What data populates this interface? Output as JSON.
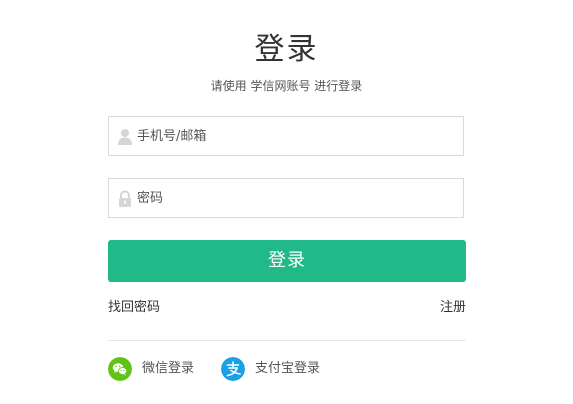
{
  "header": {
    "title": "登录",
    "subtitle": "请使用 学信网账号 进行登录"
  },
  "form": {
    "username_placeholder": "手机号/邮箱",
    "password_placeholder": "密码",
    "submit_label": "登录"
  },
  "links": {
    "forgot_password": "找回密码",
    "register": "注册"
  },
  "social_login": [
    {
      "label": "微信登录",
      "icon": "wechat-icon",
      "color": "#5fc415"
    },
    {
      "label": "支付宝登录",
      "icon": "alipay-icon",
      "color": "#1aa0e4"
    }
  ],
  "colors": {
    "primary": "#1fba88",
    "border": "#d9d9d9",
    "text": "#333333"
  }
}
